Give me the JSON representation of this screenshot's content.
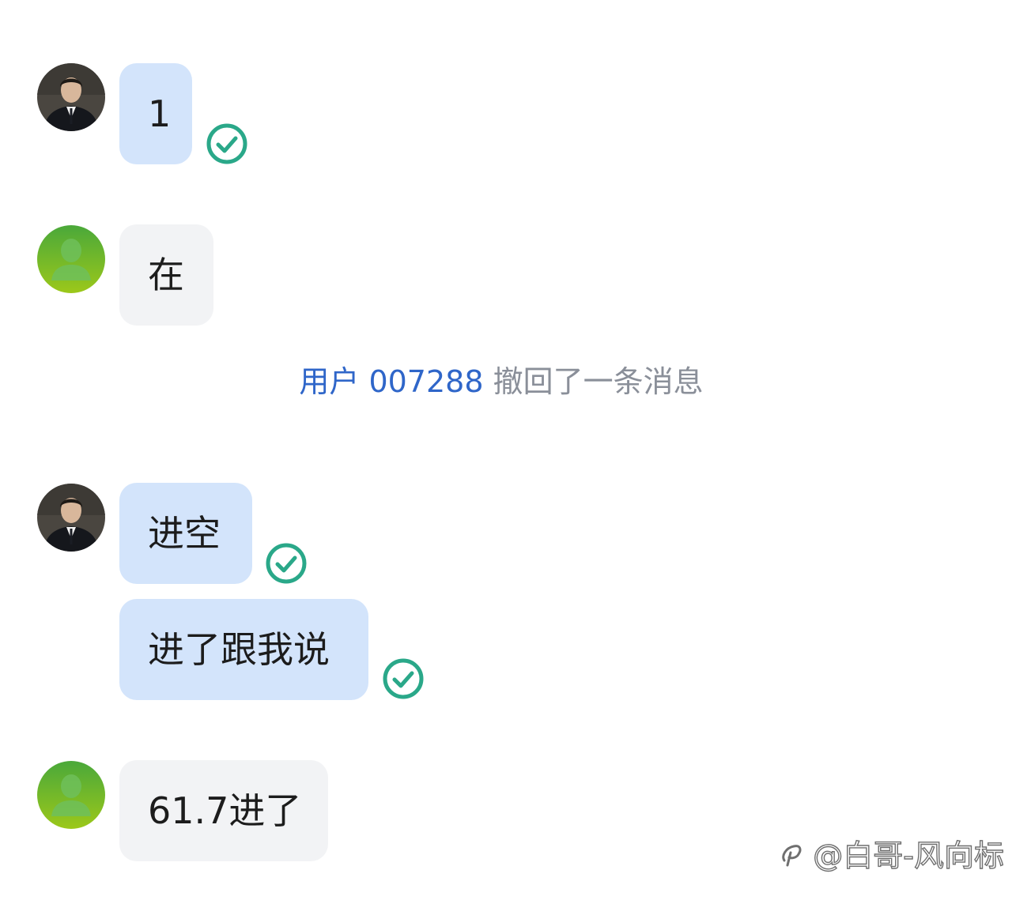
{
  "messages": [
    {
      "sender": "self",
      "avatar": "avatar-man-suit-photo",
      "text": "1",
      "status": "read-check-icon"
    },
    {
      "sender": "other",
      "avatar": "avatar-default-green",
      "text": "在"
    },
    {
      "sender": "self",
      "avatar": "avatar-man-suit-photo",
      "text": "进空",
      "status": "read-check-icon"
    },
    {
      "sender": "self",
      "text": "进了跟我说",
      "status": "read-check-icon"
    },
    {
      "sender": "other",
      "avatar": "avatar-default-green",
      "text": "61.7进了"
    }
  ],
  "recall_notice": {
    "user": "用户 007288",
    "text": " 撤回了一条消息"
  },
  "watermark": {
    "text": "@白哥-风向标"
  },
  "colors": {
    "self_bubble": "#d3e4fb",
    "other_bubble": "#f2f3f5",
    "check": "#2aa889",
    "recall_user": "#2f66c9",
    "recall_text": "#8a8f99"
  }
}
